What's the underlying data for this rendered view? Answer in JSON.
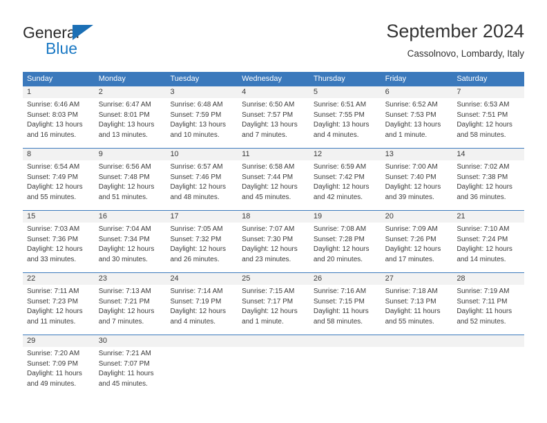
{
  "logo": {
    "word_top": "General",
    "word_bottom": "Blue",
    "triangle_color": "#1b6fb5",
    "blue_color": "#1b79c4"
  },
  "header": {
    "title": "September 2024",
    "subtitle": "Cassolnovo, Lombardy, Italy"
  },
  "calendar": {
    "header_bg": "#3b79bc",
    "daynum_bg": "#f2f2f2",
    "weekdays": [
      "Sunday",
      "Monday",
      "Tuesday",
      "Wednesday",
      "Thursday",
      "Friday",
      "Saturday"
    ],
    "weeks": [
      [
        {
          "day": "1",
          "sunrise": "Sunrise: 6:46 AM",
          "sunset": "Sunset: 8:03 PM",
          "daylight_1": "Daylight: 13 hours",
          "daylight_2": "and 16 minutes."
        },
        {
          "day": "2",
          "sunrise": "Sunrise: 6:47 AM",
          "sunset": "Sunset: 8:01 PM",
          "daylight_1": "Daylight: 13 hours",
          "daylight_2": "and 13 minutes."
        },
        {
          "day": "3",
          "sunrise": "Sunrise: 6:48 AM",
          "sunset": "Sunset: 7:59 PM",
          "daylight_1": "Daylight: 13 hours",
          "daylight_2": "and 10 minutes."
        },
        {
          "day": "4",
          "sunrise": "Sunrise: 6:50 AM",
          "sunset": "Sunset: 7:57 PM",
          "daylight_1": "Daylight: 13 hours",
          "daylight_2": "and 7 minutes."
        },
        {
          "day": "5",
          "sunrise": "Sunrise: 6:51 AM",
          "sunset": "Sunset: 7:55 PM",
          "daylight_1": "Daylight: 13 hours",
          "daylight_2": "and 4 minutes."
        },
        {
          "day": "6",
          "sunrise": "Sunrise: 6:52 AM",
          "sunset": "Sunset: 7:53 PM",
          "daylight_1": "Daylight: 13 hours",
          "daylight_2": "and 1 minute."
        },
        {
          "day": "7",
          "sunrise": "Sunrise: 6:53 AM",
          "sunset": "Sunset: 7:51 PM",
          "daylight_1": "Daylight: 12 hours",
          "daylight_2": "and 58 minutes."
        }
      ],
      [
        {
          "day": "8",
          "sunrise": "Sunrise: 6:54 AM",
          "sunset": "Sunset: 7:49 PM",
          "daylight_1": "Daylight: 12 hours",
          "daylight_2": "and 55 minutes."
        },
        {
          "day": "9",
          "sunrise": "Sunrise: 6:56 AM",
          "sunset": "Sunset: 7:48 PM",
          "daylight_1": "Daylight: 12 hours",
          "daylight_2": "and 51 minutes."
        },
        {
          "day": "10",
          "sunrise": "Sunrise: 6:57 AM",
          "sunset": "Sunset: 7:46 PM",
          "daylight_1": "Daylight: 12 hours",
          "daylight_2": "and 48 minutes."
        },
        {
          "day": "11",
          "sunrise": "Sunrise: 6:58 AM",
          "sunset": "Sunset: 7:44 PM",
          "daylight_1": "Daylight: 12 hours",
          "daylight_2": "and 45 minutes."
        },
        {
          "day": "12",
          "sunrise": "Sunrise: 6:59 AM",
          "sunset": "Sunset: 7:42 PM",
          "daylight_1": "Daylight: 12 hours",
          "daylight_2": "and 42 minutes."
        },
        {
          "day": "13",
          "sunrise": "Sunrise: 7:00 AM",
          "sunset": "Sunset: 7:40 PM",
          "daylight_1": "Daylight: 12 hours",
          "daylight_2": "and 39 minutes."
        },
        {
          "day": "14",
          "sunrise": "Sunrise: 7:02 AM",
          "sunset": "Sunset: 7:38 PM",
          "daylight_1": "Daylight: 12 hours",
          "daylight_2": "and 36 minutes."
        }
      ],
      [
        {
          "day": "15",
          "sunrise": "Sunrise: 7:03 AM",
          "sunset": "Sunset: 7:36 PM",
          "daylight_1": "Daylight: 12 hours",
          "daylight_2": "and 33 minutes."
        },
        {
          "day": "16",
          "sunrise": "Sunrise: 7:04 AM",
          "sunset": "Sunset: 7:34 PM",
          "daylight_1": "Daylight: 12 hours",
          "daylight_2": "and 30 minutes."
        },
        {
          "day": "17",
          "sunrise": "Sunrise: 7:05 AM",
          "sunset": "Sunset: 7:32 PM",
          "daylight_1": "Daylight: 12 hours",
          "daylight_2": "and 26 minutes."
        },
        {
          "day": "18",
          "sunrise": "Sunrise: 7:07 AM",
          "sunset": "Sunset: 7:30 PM",
          "daylight_1": "Daylight: 12 hours",
          "daylight_2": "and 23 minutes."
        },
        {
          "day": "19",
          "sunrise": "Sunrise: 7:08 AM",
          "sunset": "Sunset: 7:28 PM",
          "daylight_1": "Daylight: 12 hours",
          "daylight_2": "and 20 minutes."
        },
        {
          "day": "20",
          "sunrise": "Sunrise: 7:09 AM",
          "sunset": "Sunset: 7:26 PM",
          "daylight_1": "Daylight: 12 hours",
          "daylight_2": "and 17 minutes."
        },
        {
          "day": "21",
          "sunrise": "Sunrise: 7:10 AM",
          "sunset": "Sunset: 7:24 PM",
          "daylight_1": "Daylight: 12 hours",
          "daylight_2": "and 14 minutes."
        }
      ],
      [
        {
          "day": "22",
          "sunrise": "Sunrise: 7:11 AM",
          "sunset": "Sunset: 7:23 PM",
          "daylight_1": "Daylight: 12 hours",
          "daylight_2": "and 11 minutes."
        },
        {
          "day": "23",
          "sunrise": "Sunrise: 7:13 AM",
          "sunset": "Sunset: 7:21 PM",
          "daylight_1": "Daylight: 12 hours",
          "daylight_2": "and 7 minutes."
        },
        {
          "day": "24",
          "sunrise": "Sunrise: 7:14 AM",
          "sunset": "Sunset: 7:19 PM",
          "daylight_1": "Daylight: 12 hours",
          "daylight_2": "and 4 minutes."
        },
        {
          "day": "25",
          "sunrise": "Sunrise: 7:15 AM",
          "sunset": "Sunset: 7:17 PM",
          "daylight_1": "Daylight: 12 hours",
          "daylight_2": "and 1 minute."
        },
        {
          "day": "26",
          "sunrise": "Sunrise: 7:16 AM",
          "sunset": "Sunset: 7:15 PM",
          "daylight_1": "Daylight: 11 hours",
          "daylight_2": "and 58 minutes."
        },
        {
          "day": "27",
          "sunrise": "Sunrise: 7:18 AM",
          "sunset": "Sunset: 7:13 PM",
          "daylight_1": "Daylight: 11 hours",
          "daylight_2": "and 55 minutes."
        },
        {
          "day": "28",
          "sunrise": "Sunrise: 7:19 AM",
          "sunset": "Sunset: 7:11 PM",
          "daylight_1": "Daylight: 11 hours",
          "daylight_2": "and 52 minutes."
        }
      ],
      [
        {
          "day": "29",
          "sunrise": "Sunrise: 7:20 AM",
          "sunset": "Sunset: 7:09 PM",
          "daylight_1": "Daylight: 11 hours",
          "daylight_2": "and 49 minutes."
        },
        {
          "day": "30",
          "sunrise": "Sunrise: 7:21 AM",
          "sunset": "Sunset: 7:07 PM",
          "daylight_1": "Daylight: 11 hours",
          "daylight_2": "and 45 minutes."
        },
        {
          "day": "",
          "sunrise": "",
          "sunset": "",
          "daylight_1": "",
          "daylight_2": ""
        },
        {
          "day": "",
          "sunrise": "",
          "sunset": "",
          "daylight_1": "",
          "daylight_2": ""
        },
        {
          "day": "",
          "sunrise": "",
          "sunset": "",
          "daylight_1": "",
          "daylight_2": ""
        },
        {
          "day": "",
          "sunrise": "",
          "sunset": "",
          "daylight_1": "",
          "daylight_2": ""
        },
        {
          "day": "",
          "sunrise": "",
          "sunset": "",
          "daylight_1": "",
          "daylight_2": ""
        }
      ]
    ]
  }
}
